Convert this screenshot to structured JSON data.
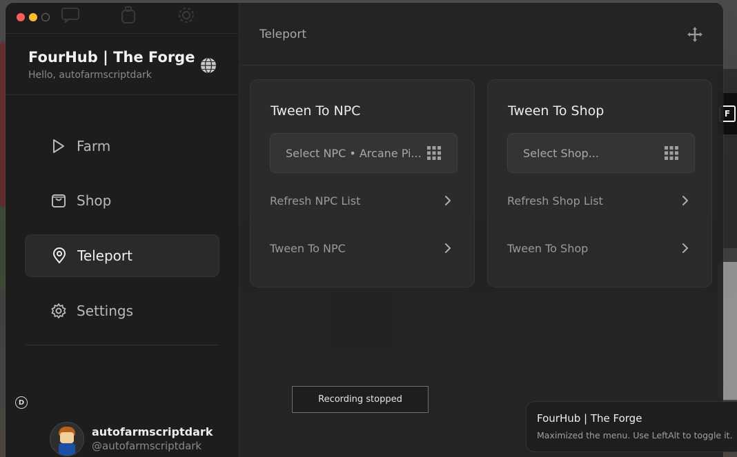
{
  "app": {
    "title": "FourHub | The Forge",
    "greeting": "Hello, autofarmscriptdark"
  },
  "sidebar": {
    "items": [
      {
        "label": "Farm",
        "icon": "play-icon",
        "active": false
      },
      {
        "label": "Shop",
        "icon": "shopping-bag-icon",
        "active": false
      },
      {
        "label": "Teleport",
        "icon": "map-pin-icon",
        "active": true
      },
      {
        "label": "Settings",
        "icon": "gear-icon",
        "active": false
      }
    ]
  },
  "user": {
    "name": "autofarmscriptdark",
    "handle": "@autofarmscriptdark"
  },
  "main": {
    "title": "Teleport",
    "cards": [
      {
        "title": "Tween To NPC",
        "dropdown_value": "Select NPC • Arcane Pi...",
        "actions": [
          "Refresh NPC List",
          "Tween To NPC"
        ]
      },
      {
        "title": "Tween To Shop",
        "dropdown_value": "Select Shop...",
        "actions": [
          "Refresh Shop List",
          "Tween To Shop"
        ]
      }
    ]
  },
  "toast": {
    "text": "Recording stopped"
  },
  "notification": {
    "title": "FourHub | The Forge",
    "body": "Maximized the menu. Use LeftAlt to toggle it."
  },
  "colors": {
    "accent_red": "#ff5f57",
    "accent_yellow": "#febc2e",
    "panel_bg": "#222222",
    "text_primary": "#ededed",
    "text_muted": "#8a8a8a"
  }
}
